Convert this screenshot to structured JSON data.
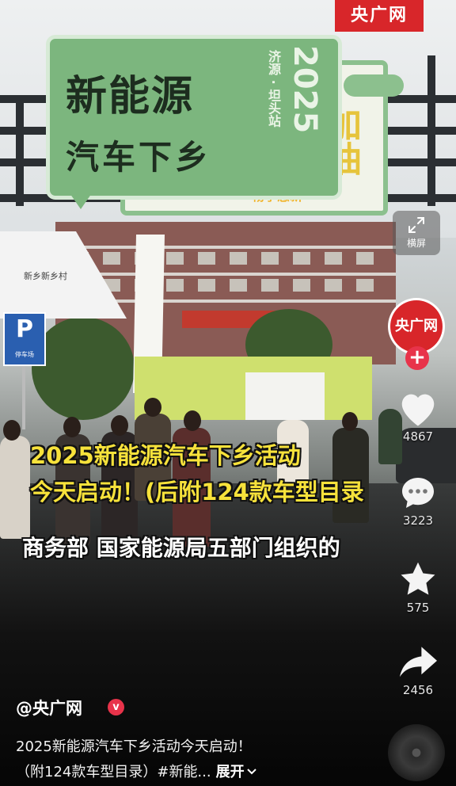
{
  "watermark": "央广网",
  "scene": {
    "board_line1": "新能源",
    "board_line2": "汽车下乡",
    "board_year": "2025",
    "board_location": "济源 · 坦头站",
    "board_back_text": "加油",
    "board_back_slogan": "畅享惠新",
    "parking_letter": "P",
    "parking_sub": "停车场",
    "tent_text": "新乡新乡村"
  },
  "subtitles": {
    "line1": "2025新能源汽车下乡活动",
    "line2": "今天启动！(后附124款车型目录",
    "line3": "商务部 国家能源局五部门组织的"
  },
  "rail": {
    "fullscreen_label": "横屏",
    "avatar_text": "央广网",
    "follow_symbol": "+",
    "like_count": "4867",
    "comment_count": "3223",
    "favorite_count": "575",
    "share_count": "2456"
  },
  "info": {
    "author": "@央广网",
    "verified_symbol": "v",
    "description_line1": "2025新能源汽车下乡活动今天启动！",
    "description_line2": "（附124款车型目录）#新能...",
    "expand_label": "展开"
  },
  "colors": {
    "accent_red": "#d8262a",
    "subtitle_yellow": "#f7e23b",
    "board_green": "#7cb67e"
  }
}
